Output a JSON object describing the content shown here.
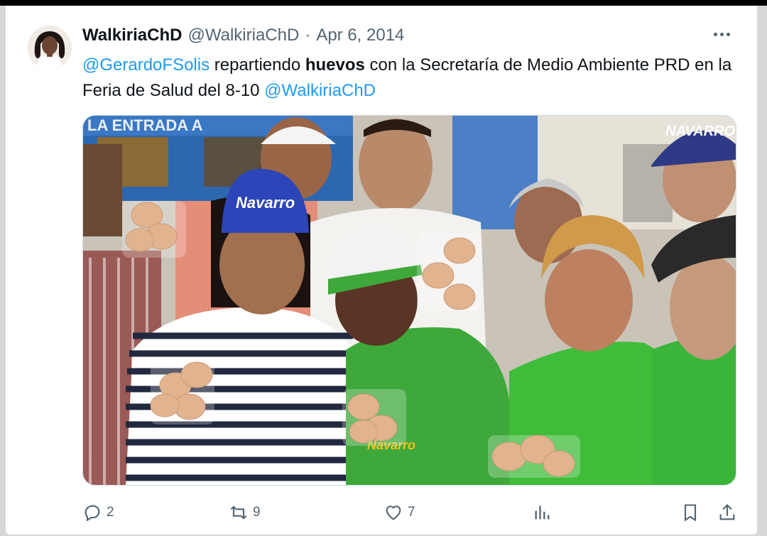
{
  "tweet": {
    "author_name": "WalkiriaChD",
    "author_handle": "@WalkiriaChD",
    "separator": "·",
    "date": "Apr 6, 2014",
    "text_parts": {
      "mention1": "@GerardoFSolis",
      "t1": " repartiendo ",
      "bold1": "huevos",
      "t2": " con la Secretaría de Medio Ambiente PRD en la Feria de Salud del 8-10 ",
      "mention2": "@WalkiriaChD"
    },
    "image_sign": "LA ENTRADA A",
    "cap_brand": "Navarro",
    "cap_brand_upper": "NAVARRO",
    "shirt_brand": "Navarro"
  },
  "actions": {
    "replies": "2",
    "reposts": "9",
    "likes": "7",
    "views": "",
    "bookmark": "",
    "share": ""
  },
  "icons": [
    "more-icon",
    "reply-icon",
    "repost-icon",
    "like-icon",
    "views-icon",
    "bookmark-icon",
    "share-icon"
  ],
  "colors": {
    "link": "#1d9bf0",
    "muted": "#536471",
    "text": "#0f1419"
  }
}
